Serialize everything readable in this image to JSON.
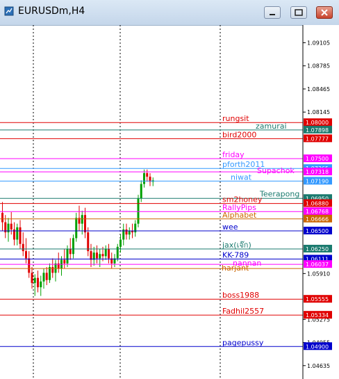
{
  "window": {
    "title": "EURUSDm,H4",
    "controls": [
      "minimize",
      "restore",
      "close"
    ]
  },
  "chart_data": {
    "type": "candlestick",
    "symbol": "EURUSDm",
    "timeframe": "H4",
    "ylim": [
      1.0445,
      1.0935
    ],
    "price_axis_ticks": [
      "1.09105",
      "1.08785",
      "1.08465",
      "1.08145",
      "1.05910",
      "1.05275",
      "1.04955",
      "1.04635"
    ],
    "levels": [
      {
        "label": "rungsit",
        "price": 1.08,
        "tag": "1.08000",
        "color": "#e00000"
      },
      {
        "label": "zamurai",
        "price": 1.07898,
        "tag": "1.07898",
        "color": "#1a7a6e"
      },
      {
        "label": "bird2000",
        "price": 1.07777,
        "tag": "1.07777",
        "color": "#e00000"
      },
      {
        "label": "friday",
        "price": 1.075,
        "tag": "1.07500",
        "color": "#ff00ff"
      },
      {
        "label": "pforth2011",
        "price": 1.07365,
        "tag": "1.07365",
        "color": "#3399ff"
      },
      {
        "label": "Supachok",
        "price": 1.07318,
        "tag": "1.07318",
        "color": "#ff00ff"
      },
      {
        "label": "niwat",
        "price": 1.0719,
        "tag": "1.07190",
        "color": "#3399ff"
      },
      {
        "label": "Teerapong",
        "price": 1.0695,
        "tag": "1.06950",
        "color": "#1a7a6e"
      },
      {
        "label": "sm2honey",
        "price": 1.0688,
        "tag": "1.06880",
        "color": "#e00000"
      },
      {
        "label": "RallyPips",
        "price": 1.06768,
        "tag": "1.06768",
        "color": "#ff00ff"
      },
      {
        "label": "Alphabet",
        "price": 1.06666,
        "tag": "1.06666",
        "color": "#cc6600"
      },
      {
        "label": "wee",
        "price": 1.065,
        "tag": "1.06500",
        "color": "#0000cc"
      },
      {
        "label": "jax(เจ๊ก)",
        "price": 1.0625,
        "tag": "1.06250",
        "color": "#1a7a6e"
      },
      {
        "label": "KK-789",
        "price": 1.06111,
        "tag": "1.06111",
        "color": "#0000cc"
      },
      {
        "label": "nannan",
        "price": 1.06037,
        "tag": "1.06037",
        "color": "#ff00ff"
      },
      {
        "label": "harjant",
        "price": 1.0598,
        "tag": "",
        "color": "#cc6600"
      },
      {
        "label": "boss1988",
        "price": 1.05555,
        "tag": "1.05555",
        "color": "#e00000"
      },
      {
        "label": "Fadhil2557",
        "price": 1.05334,
        "tag": "1.05334",
        "color": "#e00000"
      },
      {
        "label": "pagepussy",
        "price": 1.049,
        "tag": "1.04900",
        "color": "#0000cc"
      }
    ],
    "candles": [
      [
        1.0675,
        1.069,
        1.065,
        1.0662
      ],
      [
        1.0662,
        1.0672,
        1.064,
        1.0648
      ],
      [
        1.0648,
        1.0668,
        1.0635,
        1.066
      ],
      [
        1.066,
        1.0676,
        1.0645,
        1.0652
      ],
      [
        1.0652,
        1.0662,
        1.063,
        1.0638
      ],
      [
        1.0638,
        1.066,
        1.063,
        1.0655
      ],
      [
        1.0655,
        1.0665,
        1.0625,
        1.0632
      ],
      [
        1.0632,
        1.0648,
        1.0615,
        1.0622
      ],
      [
        1.0622,
        1.064,
        1.0605,
        1.0612
      ],
      [
        1.0612,
        1.0622,
        1.0585,
        1.0592
      ],
      [
        1.0592,
        1.06,
        1.057,
        1.0578
      ],
      [
        1.0578,
        1.059,
        1.056,
        1.0585
      ],
      [
        1.0585,
        1.0595,
        1.0565,
        1.0572
      ],
      [
        1.0572,
        1.0588,
        1.056,
        1.058
      ],
      [
        1.058,
        1.0598,
        1.057,
        1.0592
      ],
      [
        1.0592,
        1.06,
        1.0575,
        1.0582
      ],
      [
        1.0582,
        1.0605,
        1.0578,
        1.06
      ],
      [
        1.06,
        1.0612,
        1.0585,
        1.0592
      ],
      [
        1.0592,
        1.061,
        1.058,
        1.0605
      ],
      [
        1.0605,
        1.062,
        1.0592,
        1.0598
      ],
      [
        1.0598,
        1.0615,
        1.0588,
        1.061
      ],
      [
        1.061,
        1.0625,
        1.0598,
        1.0605
      ],
      [
        1.0605,
        1.063,
        1.06,
        1.0625
      ],
      [
        1.0625,
        1.064,
        1.061,
        1.0618
      ],
      [
        1.0618,
        1.0645,
        1.0612,
        1.064
      ],
      [
        1.064,
        1.0675,
        1.0635,
        1.0668
      ],
      [
        1.0668,
        1.0685,
        1.065,
        1.066
      ],
      [
        1.066,
        1.0678,
        1.0645,
        1.0672
      ],
      [
        1.0672,
        1.0682,
        1.064,
        1.0648
      ],
      [
        1.0648,
        1.0655,
        1.0615,
        1.0622
      ],
      [
        1.0622,
        1.0632,
        1.06,
        1.061
      ],
      [
        1.061,
        1.0628,
        1.0602,
        1.062
      ],
      [
        1.062,
        1.063,
        1.0605,
        1.0612
      ],
      [
        1.0612,
        1.0625,
        1.06,
        1.0618
      ],
      [
        1.0618,
        1.0628,
        1.0608,
        1.0615
      ],
      [
        1.0615,
        1.063,
        1.061,
        1.0625
      ],
      [
        1.0625,
        1.0632,
        1.0605,
        1.0612
      ],
      [
        1.0612,
        1.062,
        1.0598,
        1.0605
      ],
      [
        1.0605,
        1.0618,
        1.06,
        1.0612
      ],
      [
        1.0612,
        1.0632,
        1.0608,
        1.0628
      ],
      [
        1.0628,
        1.0645,
        1.062,
        1.0638
      ],
      [
        1.0638,
        1.066,
        1.063,
        1.0652
      ],
      [
        1.0652,
        1.066,
        1.0638,
        1.0645
      ],
      [
        1.0645,
        1.0655,
        1.0638,
        1.065
      ],
      [
        1.065,
        1.066,
        1.064,
        1.0648
      ],
      [
        1.0648,
        1.0665,
        1.0642,
        1.066
      ],
      [
        1.066,
        1.07,
        1.0655,
        1.0695
      ],
      [
        1.0695,
        1.072,
        1.069,
        1.0715
      ],
      [
        1.0715,
        1.0735,
        1.071,
        1.073
      ],
      [
        1.073,
        1.0735,
        1.0718,
        1.0725
      ],
      [
        1.0725,
        1.073,
        1.0712,
        1.0718
      ],
      [
        1.0718,
        1.0724,
        1.0712,
        1.072
      ]
    ],
    "colors": {
      "bull": "#00a000",
      "bear": "#e00000",
      "grid": "#000000"
    }
  }
}
